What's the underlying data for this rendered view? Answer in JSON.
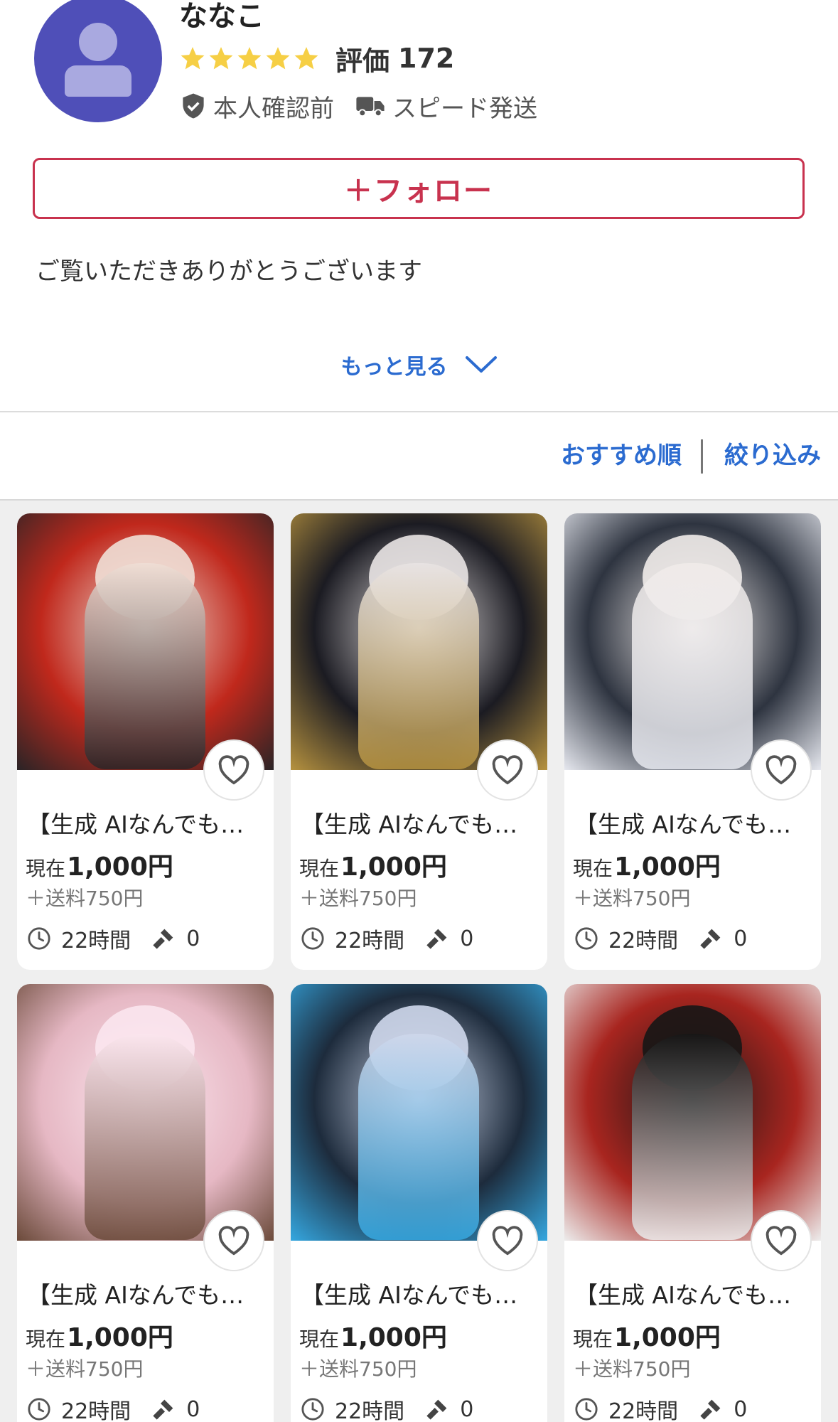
{
  "profile": {
    "username": "ななこ",
    "rating_stars": 5,
    "rating_label": "評価",
    "rating_count": "172",
    "badges": {
      "identity": "本人確認前",
      "shipping": "スピード発送"
    },
    "follow_label": "＋フォロー",
    "intro": "ご覧いただきありがとうございます",
    "more_label": "もっと見る"
  },
  "sortbar": {
    "sort_label": "おすすめ順",
    "filter_label": "絞り込み"
  },
  "products": [
    {
      "title": "【生成 AIなんでも…",
      "price_label": "現在",
      "price": "1,000円",
      "shipping": "＋送料750円",
      "time_left": "22時間",
      "bids": "0",
      "thumb_colors": [
        "#c0281c",
        "#f0dfd6",
        "#2a2426"
      ]
    },
    {
      "title": "【生成 AIなんでも…",
      "price_label": "現在",
      "price": "1,000円",
      "shipping": "＋送料750円",
      "time_left": "22時間",
      "bids": "0",
      "thumb_colors": [
        "#1b1b22",
        "#e9e4e4",
        "#b6923f"
      ]
    },
    {
      "title": "【生成 AIなんでも…",
      "price_label": "現在",
      "price": "1,000円",
      "shipping": "＋送料750円",
      "time_left": "22時間",
      "bids": "0",
      "thumb_colors": [
        "#2e3440",
        "#f1ecea",
        "#e6e8ef"
      ]
    },
    {
      "title": "【生成 AIなんでも…",
      "price_label": "現在",
      "price": "1,000円",
      "shipping": "＋送料750円",
      "time_left": "22時間",
      "bids": "0",
      "thumb_colors": [
        "#e6b8c4",
        "#fbe6ee",
        "#6b4a3a"
      ]
    },
    {
      "title": "【生成 AIなんでも…",
      "price_label": "現在",
      "price": "1,000円",
      "shipping": "＋送料750円",
      "time_left": "22時間",
      "bids": "0",
      "thumb_colors": [
        "#1d2b3c",
        "#cfd8ec",
        "#35a7e0"
      ]
    },
    {
      "title": "【生成 AIなんでも…",
      "price_label": "現在",
      "price": "1,000円",
      "shipping": "＋送料750円",
      "time_left": "22時間",
      "bids": "0",
      "thumb_colors": [
        "#a8251f",
        "#161616",
        "#ededed"
      ]
    }
  ],
  "colors": {
    "accent_red": "#c8324e",
    "link_blue": "#2b6bd0",
    "star_yellow": "#f6cf45",
    "avatar_bg": "#4f4fb8"
  }
}
